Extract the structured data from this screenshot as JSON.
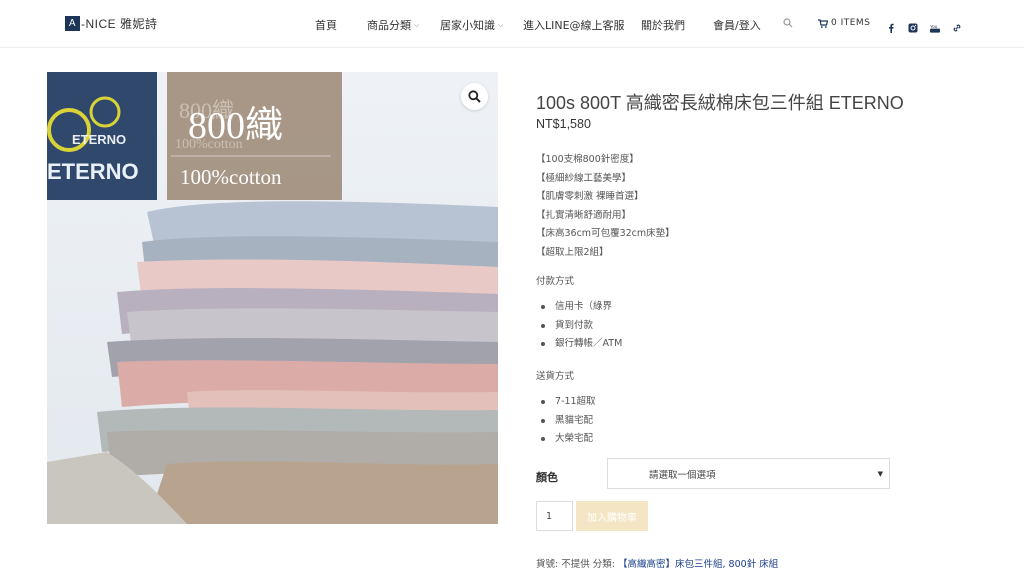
{
  "header": {
    "logo_letter": "A",
    "logo_text": "-NICE 雅妮詩",
    "nav": {
      "home": "首頁",
      "category": "商品分類",
      "knowledge": "居家小知識",
      "line": "進入LINE@線上客服",
      "about": "關於我們",
      "member": "會員/登入"
    },
    "cart_label": "0 ITEMS",
    "social_icons": [
      "facebook-icon",
      "instagram-icon",
      "youtube-icon",
      "link-icon"
    ]
  },
  "product_image": {
    "brand_text": "ETERNO",
    "badge_main": "800織",
    "badge_sub": "100%cotton",
    "badge_ghost_main": "800織",
    "badge_ghost_sub": "100%cotton"
  },
  "product": {
    "title": "100s 800T 高織密長絨棉床包三件組 ETERNO",
    "price": "NT$1,580",
    "features": [
      "【100支棉800針密度】",
      "【極細紗線工藝美學】",
      "【肌膚零刺激 裸睡首選】",
      "【扎實清晰舒適耐用】",
      "【床高36cm可包覆32cm床墊】",
      "【超取上限2組】"
    ],
    "payment_label": "付款方式",
    "payment_methods": [
      "信用卡（綠界",
      "貨到付款",
      "銀行轉帳／ATM"
    ],
    "shipping_label": "送貨方式",
    "shipping_methods": [
      "7-11超取",
      "黑貓宅配",
      "大榮宅配"
    ],
    "color_label": "顏色",
    "color_select": "請選取一個選項",
    "quantity": "1",
    "add_to_cart": "加入購物車",
    "meta_sku_label": "貨號:",
    "meta_sku_value": "不提供",
    "meta_category_label": "分類:",
    "meta_categories": "【高織高密】床包三件組, 800針 床組"
  },
  "colors": {
    "accent_navy": "#1d3557",
    "add_to_cart_bg": "#f4e6c4",
    "link": "#1a3f8b"
  }
}
